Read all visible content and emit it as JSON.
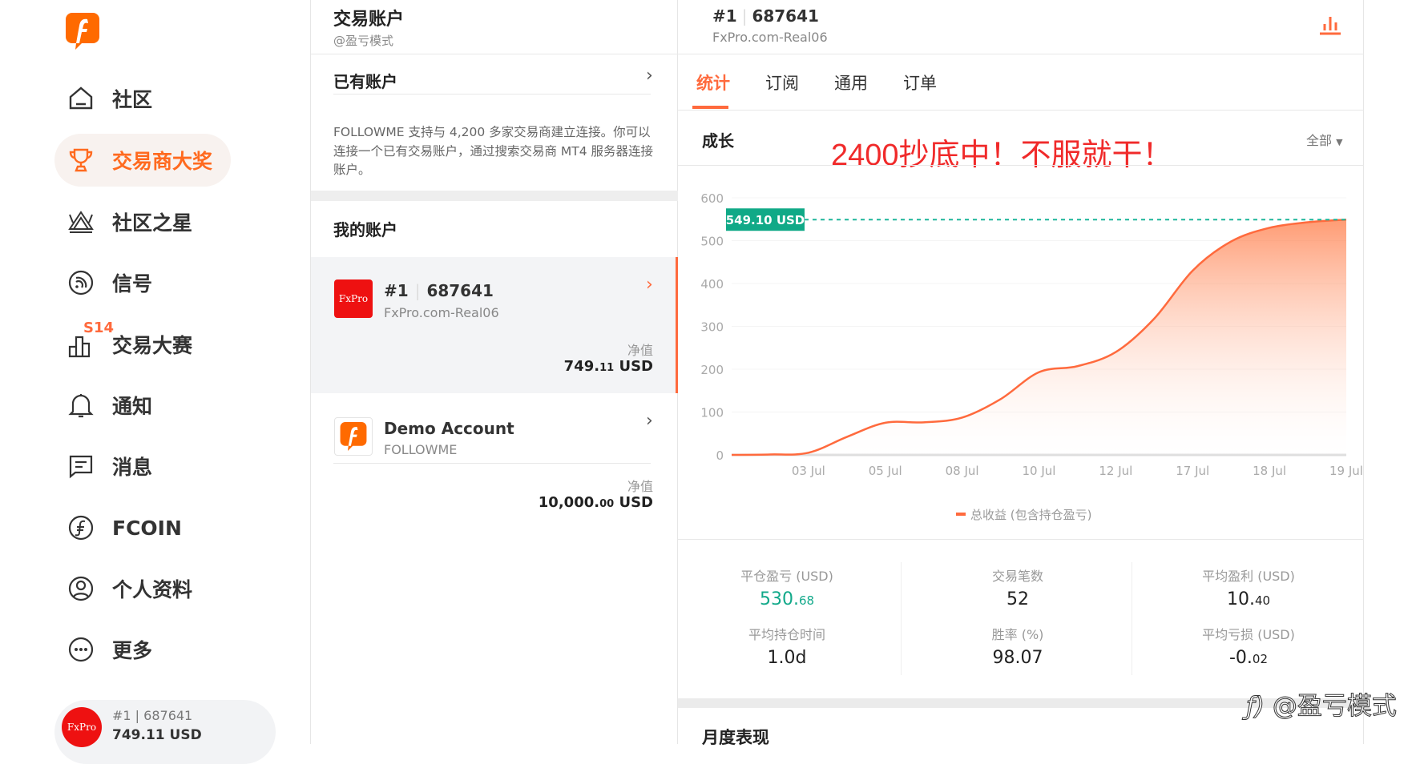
{
  "sidebar": {
    "items": [
      {
        "label": "社区",
        "icon": "home-icon"
      },
      {
        "label": "交易商大奖",
        "icon": "trophy-icon",
        "active": true
      },
      {
        "label": "社区之星",
        "icon": "crown-icon"
      },
      {
        "label": "信号",
        "icon": "signal-icon"
      },
      {
        "label": "交易大赛",
        "icon": "contest-icon",
        "badge": "S14"
      },
      {
        "label": "通知",
        "icon": "bell-icon"
      },
      {
        "label": "消息",
        "icon": "message-icon"
      },
      {
        "label": "FCOIN",
        "icon": "fcoin-icon"
      },
      {
        "label": "个人资料",
        "icon": "profile-icon"
      },
      {
        "label": "更多",
        "icon": "more-icon"
      }
    ],
    "account": {
      "avatar": "FxPro",
      "id": "#1 | 687641",
      "equity": "749.11 USD"
    }
  },
  "middle": {
    "title": "交易账户",
    "subtitle": "@盈亏模式",
    "existing": "已有账户",
    "description": "FOLLOWME 支持与 4,200 多家交易商建立连接。你可以连接一个已有交易账户，通过搜索交易商 MT4 服务器连接账户。",
    "my_accounts": "我的账户",
    "accounts": [
      {
        "logo": "FxPro",
        "num": "#1",
        "id": "687641",
        "server": "FxPro.com-Real06",
        "equity_label": "净值",
        "equity_int": "749.",
        "equity_dec": "11",
        "currency": "USD"
      },
      {
        "logo": "f",
        "name": "Demo Account",
        "server": "FOLLOWME",
        "equity_label": "净值",
        "equity_int": "10,000.",
        "equity_dec": "00",
        "currency": "USD"
      }
    ]
  },
  "right": {
    "num": "#1",
    "id": "687641",
    "server": "FxPro.com-Real06",
    "tabs": [
      "统计",
      "订阅",
      "通用",
      "订单"
    ],
    "section": "成长",
    "annotation": "2400抄底中！不服就干！",
    "filter": "全部",
    "stats": [
      {
        "label": "平仓盈亏 (USD)",
        "int": "530.",
        "dec": "68",
        "color": "#12a98a"
      },
      {
        "label": "交易笔数",
        "int": "52",
        "dec": ""
      },
      {
        "label": "平均盈利 (USD)",
        "int": "10.",
        "dec": "40"
      },
      {
        "label": "平均持仓时间",
        "int": "1.0d",
        "dec": ""
      },
      {
        "label": "胜率 (%)",
        "int": "98.07",
        "dec": ""
      },
      {
        "label": "平均亏损 (USD)",
        "int": "-0.",
        "dec": "02"
      }
    ],
    "monthly": "月度表现",
    "watermark": "@盈亏模式"
  },
  "colors": {
    "accent": "#ff6a3d",
    "green": "#12a98a",
    "red": "#ee1111"
  },
  "chart_data": {
    "type": "area",
    "title": "成长",
    "x_labels": [
      "",
      "03 Jul",
      "05 Jul",
      "08 Jul",
      "10 Jul",
      "12 Jul",
      "17 Jul",
      "18 Jul",
      "19 Jul"
    ],
    "x": [
      0,
      0.5,
      1,
      1.5,
      2,
      2.5,
      3,
      3.5,
      4,
      4.5,
      5,
      5.5,
      6,
      6.5,
      7,
      7.5,
      8
    ],
    "series": [
      {
        "name": "总收益 (包含持仓盈亏)",
        "values": [
          0,
          1,
          5,
          42,
          75,
          76,
          87,
          130,
          193,
          207,
          240,
          318,
          430,
          498,
          530,
          543,
          549.1
        ]
      }
    ],
    "yticks": [
      0,
      100,
      200,
      300,
      400,
      500,
      600
    ],
    "ylim": [
      0,
      600
    ],
    "last_value_label": "549.10 USD",
    "last_value": 549.1,
    "legend": "bottom-center",
    "grid": true
  }
}
